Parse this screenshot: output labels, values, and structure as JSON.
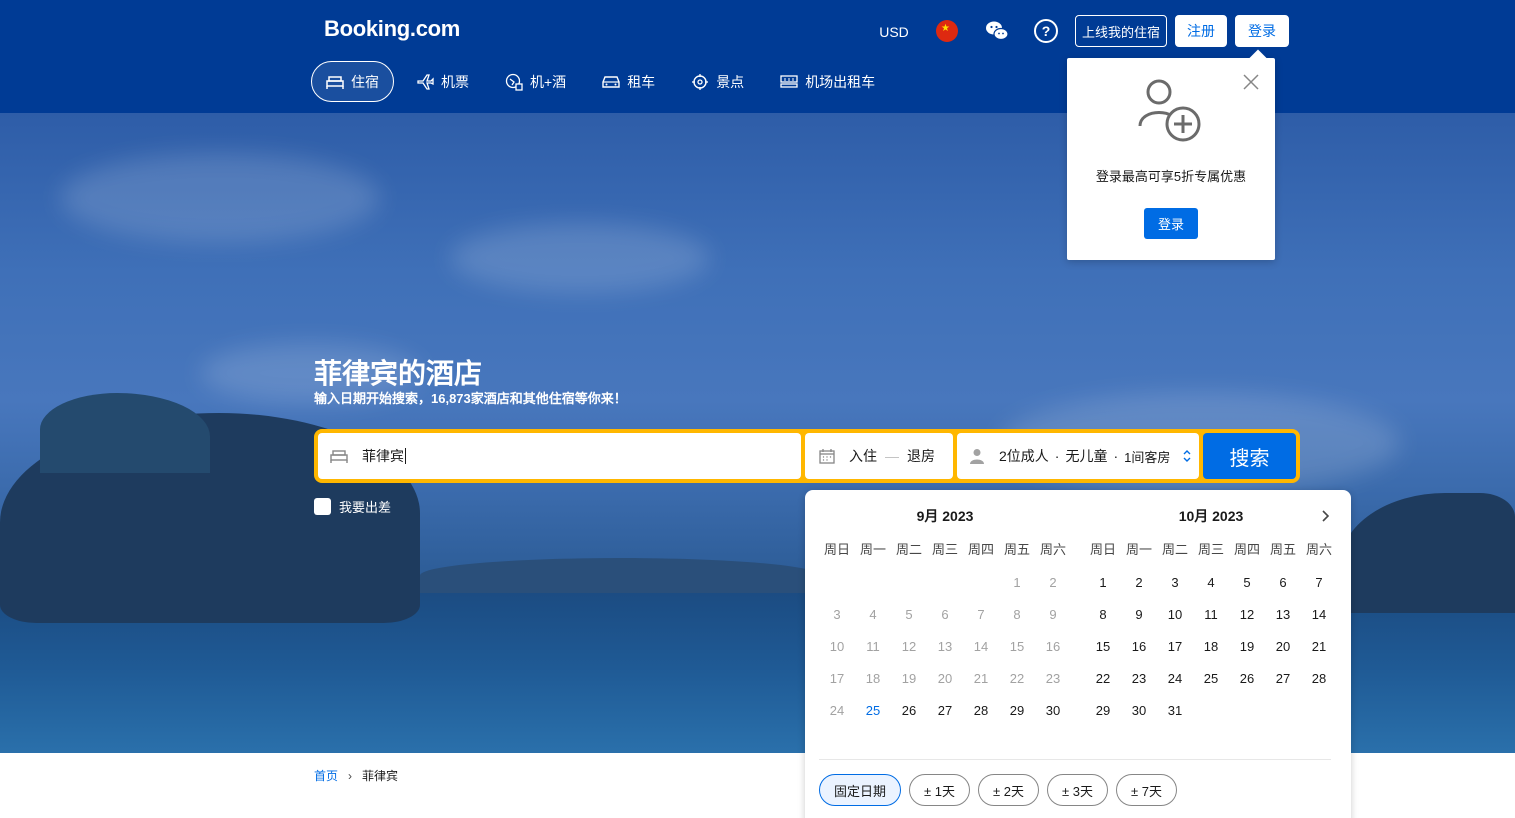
{
  "header": {
    "logo": "Booking.com",
    "currency": "USD",
    "flag_icon": "china-flag-icon",
    "list_property_label": "上线我的住宿",
    "register_label": "注册",
    "login_label": "登录"
  },
  "nav": {
    "tabs": [
      {
        "label": "住宿",
        "icon": "bed-icon",
        "active": true
      },
      {
        "label": "机票",
        "icon": "plane-icon",
        "active": false
      },
      {
        "label": "机+酒",
        "icon": "flight-hotel-icon",
        "active": false
      },
      {
        "label": "租车",
        "icon": "car-icon",
        "active": false
      },
      {
        "label": "景点",
        "icon": "attractions-icon",
        "active": false
      },
      {
        "label": "机场出租车",
        "icon": "taxi-icon",
        "active": false
      }
    ]
  },
  "hero": {
    "title": "菲律宾的酒店",
    "subtitle": "输入日期开始搜索，16,873家酒店和其他住宿等你来！"
  },
  "search": {
    "destination_value": "菲律宾",
    "checkin_label": "入住",
    "dash": "—",
    "checkout_label": "退房",
    "guests_adults": "2位成人",
    "guests_dot": "·",
    "guests_children": "无儿童",
    "guests_rooms": "1间客房",
    "search_label": "搜索",
    "business_label": "我要出差"
  },
  "calendar": {
    "weekdays": [
      "周日",
      "周一",
      "周二",
      "周三",
      "周四",
      "周五",
      "周六"
    ],
    "months": [
      {
        "title": "9月 2023",
        "lead_blanks": 5,
        "days": 30,
        "today": 25
      },
      {
        "title": "10月 2023",
        "lead_blanks": 0,
        "days": 31,
        "today": null
      }
    ],
    "chips": [
      "固定日期",
      "± 1天",
      "± 2天",
      "± 3天",
      "± 7天"
    ]
  },
  "popover": {
    "text": "登录最高可享5折专属优惠",
    "button": "登录"
  },
  "breadcrumb": {
    "home": "首页",
    "current": "菲律宾"
  },
  "colors": {
    "brand_blue": "#003b95",
    "action_blue": "#006ce4",
    "search_yellow": "#ffb700"
  }
}
